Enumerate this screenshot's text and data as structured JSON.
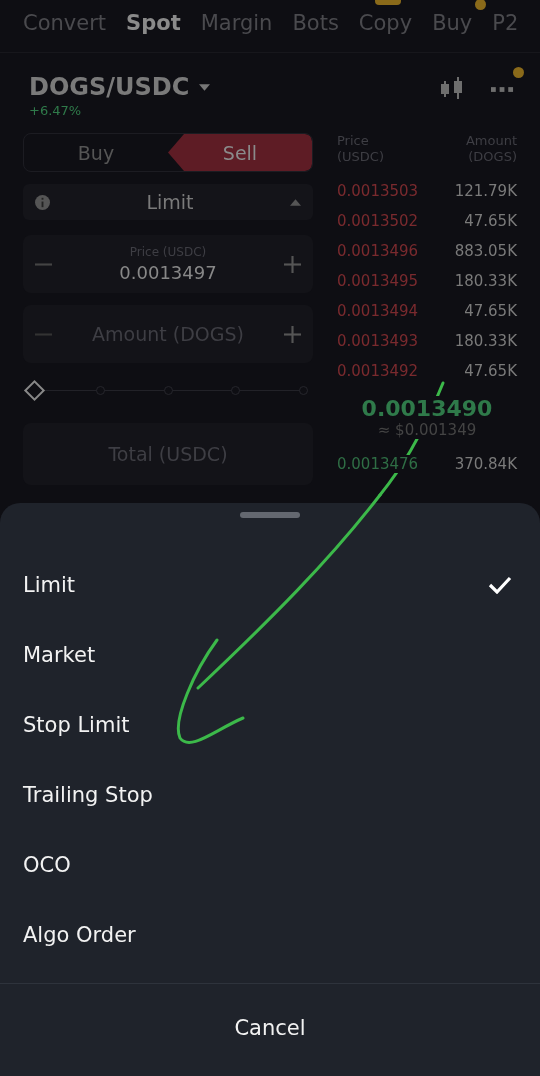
{
  "tabs": [
    {
      "label": "Convert",
      "selected": false
    },
    {
      "label": "Spot",
      "selected": true
    },
    {
      "label": "Margin",
      "selected": false
    },
    {
      "label": "Bots",
      "selected": false
    },
    {
      "label": "Copy",
      "selected": false,
      "new_badge": true
    },
    {
      "label": "Buy",
      "selected": false,
      "dot": true
    },
    {
      "label": "P2",
      "selected": false
    }
  ],
  "pair": {
    "symbol": "DOGS/USDC",
    "change": "+6.47%",
    "more_dot": true
  },
  "side_toggle": [
    {
      "label": "Buy",
      "selected": false
    },
    {
      "label": "Sell",
      "selected": true
    }
  ],
  "order_type": "Limit",
  "price_field": {
    "label": "Price (USDC)",
    "value": "0.0013497"
  },
  "amount_field": {
    "placeholder": "Amount (DOGS)"
  },
  "slider": {
    "level": 0
  },
  "total_field": {
    "placeholder": "Total (USDC)"
  },
  "order_book": {
    "columns": [
      {
        "name": "Price",
        "unit": "(USDC)"
      },
      {
        "name": "Amount",
        "unit": "(DOGS)"
      }
    ],
    "asks": [
      {
        "price": "0.0013503",
        "amount": "121.79K"
      },
      {
        "price": "0.0013502",
        "amount": "47.65K"
      },
      {
        "price": "0.0013496",
        "amount": "883.05K"
      },
      {
        "price": "0.0013495",
        "amount": "180.33K"
      },
      {
        "price": "0.0013494",
        "amount": "47.65K"
      },
      {
        "price": "0.0013493",
        "amount": "180.33K"
      },
      {
        "price": "0.0013492",
        "amount": "47.65K"
      }
    ],
    "last_price": "0.0013490",
    "last_price_usd": "≈ $0.001349",
    "bids": [
      {
        "price": "0.0013476",
        "amount": "370.84K"
      }
    ]
  },
  "sheet": {
    "options": [
      {
        "label": "Limit",
        "selected": true
      },
      {
        "label": "Market",
        "selected": false
      },
      {
        "label": "Stop Limit",
        "selected": false
      },
      {
        "label": "Trailing Stop",
        "selected": false
      },
      {
        "label": "OCO",
        "selected": false
      },
      {
        "label": "Algo Order",
        "selected": false
      }
    ],
    "cancel": "Cancel"
  }
}
